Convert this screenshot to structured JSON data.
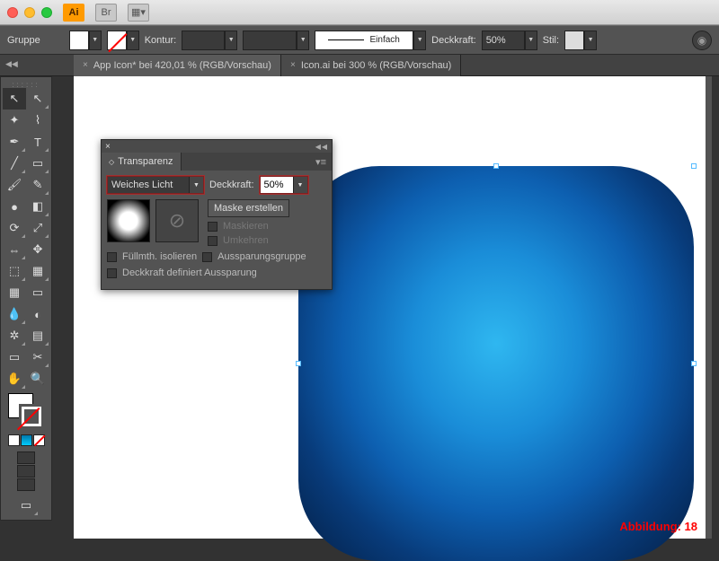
{
  "app": {
    "name": "Ai"
  },
  "titlebar_buttons": {
    "br": "Br",
    "layout": "▦"
  },
  "control": {
    "selection_label": "Gruppe",
    "stroke_label": "Kontur:",
    "stroke_value": "",
    "stroke_style": "Einfach",
    "opacity_label": "Deckkraft:",
    "opacity_value": "50%",
    "style_label": "Stil:"
  },
  "tabs": [
    {
      "label": "App Icon* bei 420,01 % (RGB/Vorschau)",
      "active": true
    },
    {
      "label": "Icon.ai bei 300 % (RGB/Vorschau)",
      "active": false
    }
  ],
  "panel": {
    "title": "Transparenz",
    "blend_mode": "Weiches Licht",
    "opacity_label": "Deckkraft:",
    "opacity_value": "50%",
    "make_mask": "Maske erstellen",
    "clip": "Maskieren",
    "invert": "Umkehren",
    "isolate": "Füllmth. isolieren",
    "knockout": "Aussparungsgruppe",
    "opacity_defines": "Deckkraft definiert Aussparung"
  },
  "figure_caption": "Abbildung: 18",
  "tool_icons": {
    "selection": "↖",
    "direct": "↖",
    "wand": "✦",
    "lasso": "⌇",
    "pen": "✒",
    "type": "T",
    "line": "╱",
    "rect": "▭",
    "brush": "🖌",
    "pencil": "✎",
    "blob": "●",
    "eraser": "◧",
    "rotate": "⟳",
    "scale": "⤢",
    "width": "⇔",
    "free": "✥",
    "shape": "⬚",
    "persp": "▦",
    "mesh": "▦",
    "gradient": "▭",
    "eyedrop": "💧",
    "blend": "◐",
    "spray": "✲",
    "graph": "▤",
    "artboard": "▭",
    "slice": "✂",
    "hand": "✋",
    "zoom": "🔍"
  }
}
